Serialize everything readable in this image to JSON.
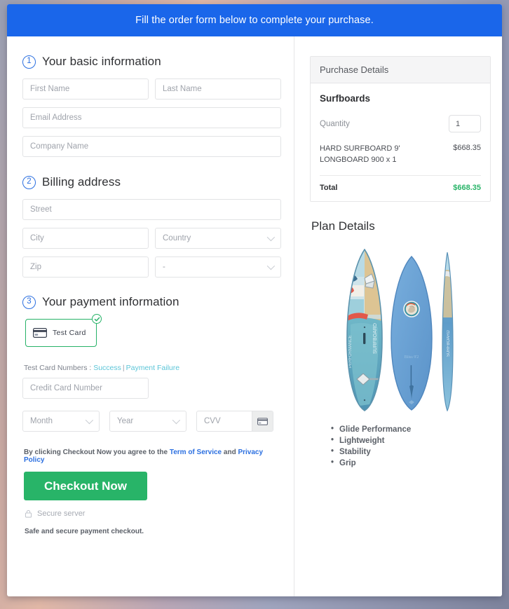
{
  "banner": {
    "text": "Fill the order form below to complete your purchase."
  },
  "steps": [
    {
      "num": "1",
      "title": "Your basic information"
    },
    {
      "num": "2",
      "title": "Billing address"
    },
    {
      "num": "3",
      "title": "Your payment information"
    }
  ],
  "basic_info": {
    "first_name": {
      "placeholder": "First Name",
      "value": ""
    },
    "last_name": {
      "placeholder": "Last Name",
      "value": ""
    },
    "email": {
      "placeholder": "Email Address",
      "value": ""
    },
    "company": {
      "placeholder": "Company Name",
      "value": ""
    }
  },
  "billing": {
    "street": {
      "placeholder": "Street",
      "value": ""
    },
    "city": {
      "placeholder": "City",
      "value": ""
    },
    "country": {
      "placeholder": "Country",
      "value": ""
    },
    "zip": {
      "placeholder": "Zip",
      "value": ""
    },
    "state": {
      "placeholder": "-",
      "value": "-"
    }
  },
  "payment": {
    "card_tile_label": "Test Card",
    "test_numbers_label": "Test Card Numbers :",
    "success_link": "Success",
    "separator": "|",
    "failure_link": "Payment Failure",
    "card_number": {
      "placeholder": "Credit Card Number",
      "value": ""
    },
    "month": {
      "placeholder": "Month",
      "value": ""
    },
    "year": {
      "placeholder": "Year",
      "value": ""
    },
    "cvv": {
      "placeholder": "CVV",
      "value": ""
    }
  },
  "footer": {
    "terms_prefix": "By clicking Checkout Now you agree to the ",
    "terms_link": "Term of Service",
    "terms_and": " and ",
    "privacy_link": "Privacy Policy",
    "checkout_label": "Checkout Now",
    "secure_server": "Secure server",
    "safe_note": "Safe and secure payment checkout."
  },
  "purchase": {
    "panel_title": "Purchase Details",
    "product_title": "Surfboards",
    "quantity_label": "Quantity",
    "quantity_value": "1",
    "line_item_name": "HARD SURFBOARD 9' LONGBOARD 900 x 1",
    "line_item_price": "$668.35",
    "total_label": "Total",
    "total_value": "$668.35"
  },
  "plan": {
    "title": "Plan Details",
    "features": [
      "Glide Performance",
      "Lightweight",
      "Stability",
      "Grip"
    ]
  },
  "colors": {
    "banner_blue": "#1a66ea",
    "accent_blue": "#2b6fe0",
    "success_green": "#28b468",
    "tile_green": "#27b268",
    "link_teal": "#5bc5d8"
  }
}
